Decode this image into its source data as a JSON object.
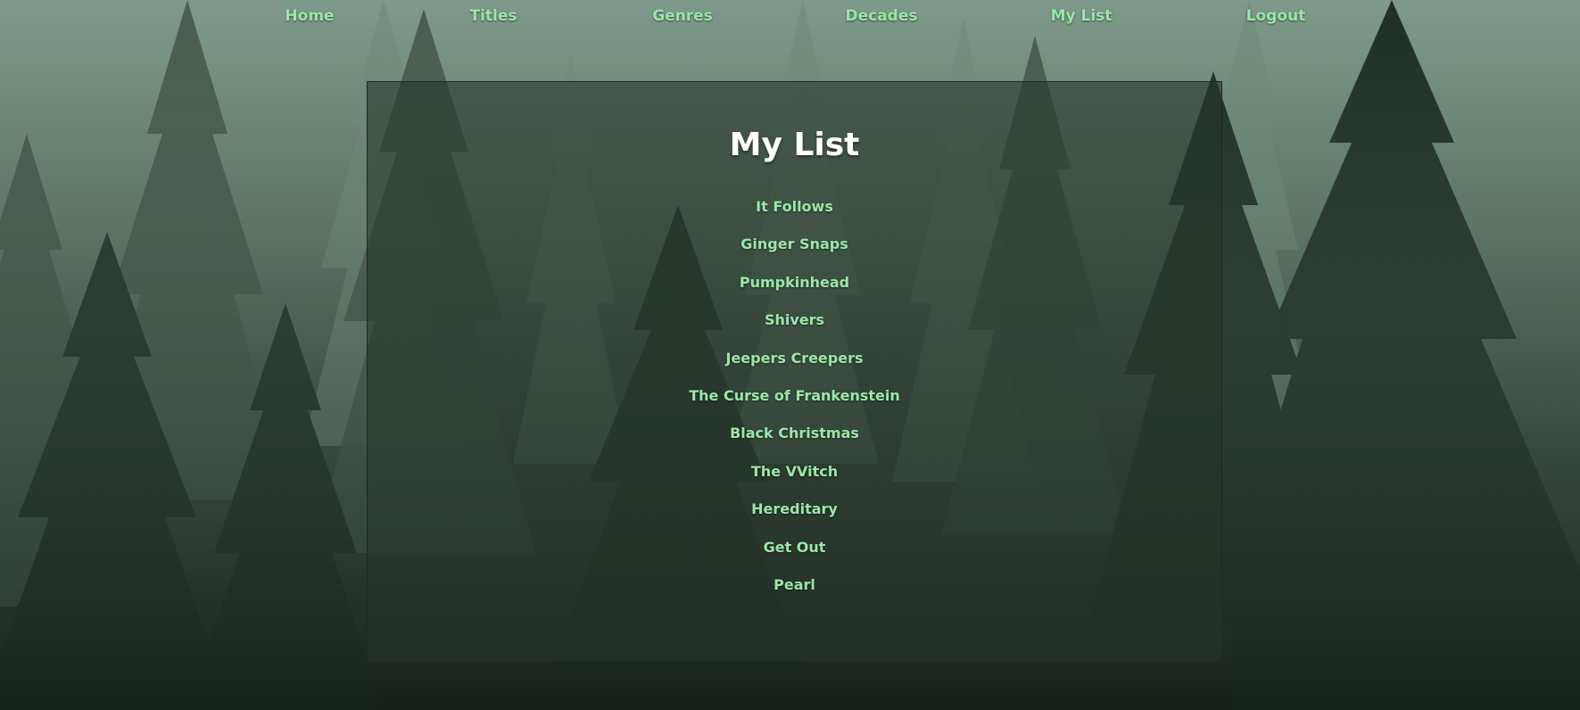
{
  "nav": {
    "items": [
      {
        "label": "Home"
      },
      {
        "label": "Titles"
      },
      {
        "label": "Genres"
      },
      {
        "label": "Decades"
      },
      {
        "label": "My List"
      },
      {
        "label": "Logout"
      }
    ]
  },
  "main": {
    "title": "My List",
    "list": [
      "It Follows",
      "Ginger Snaps",
      "Pumpkinhead",
      "Shivers",
      "Jeepers Creepers",
      "The Curse of Frankenstein",
      "Black Christmas",
      "The VVitch",
      "Hereditary",
      "Get Out",
      "Pearl"
    ]
  },
  "colors": {
    "link": "#9be6a9",
    "heading": "#ffffff",
    "panel": "#26342a"
  },
  "background": {
    "icon": "misty-pine-forest-image"
  }
}
